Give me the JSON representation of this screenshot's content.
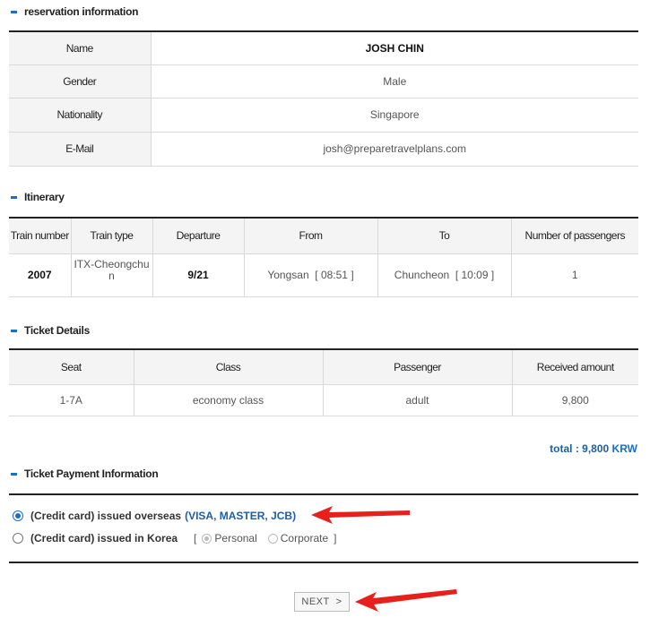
{
  "sections": {
    "reservation": "reservation information",
    "itinerary": "Itinerary",
    "ticket": "Ticket Details",
    "payment": "Ticket Payment Information"
  },
  "reservation": {
    "name_label": "Name",
    "name": "JOSH CHIN",
    "gender_label": "Gender",
    "gender": "Male",
    "nationality_label": "Nationality",
    "nationality": "Singapore",
    "email_label": "E-Mail",
    "email": "josh@preparetravelplans.com"
  },
  "itinerary": {
    "headers": [
      "Train number",
      "Train type",
      "Departure",
      "From",
      "To",
      "Number of passengers"
    ],
    "row": {
      "train_number": "2007",
      "train_type": "ITX-Cheongchun",
      "departure": "9/21",
      "from": "Yongsan  [ 08:51 ]",
      "to": "Chuncheon  [ 10:09 ]",
      "passengers": "1"
    }
  },
  "ticket": {
    "headers": [
      "Seat",
      "Class",
      "Passenger",
      "Received amount"
    ],
    "row": {
      "seat": "1-7A",
      "class": "economy class",
      "passenger": "adult",
      "amount": "9,800"
    }
  },
  "total": {
    "label": "total : 9,800",
    "currency": "KRW"
  },
  "payment": {
    "overseas_label": "(Credit card) issued overseas",
    "overseas_cards": "(VISA, MASTER, JCB)",
    "overseas_selected": true,
    "korea_label": "(Credit card) issued in Korea",
    "bracket_open": "[",
    "personal": "Personal",
    "corporate": "Corporate",
    "bracket_close": "]"
  },
  "next_button": "NEXT  >",
  "colors": {
    "accent": "#1a6fc4",
    "annotation_arrow": "#e8201c"
  }
}
